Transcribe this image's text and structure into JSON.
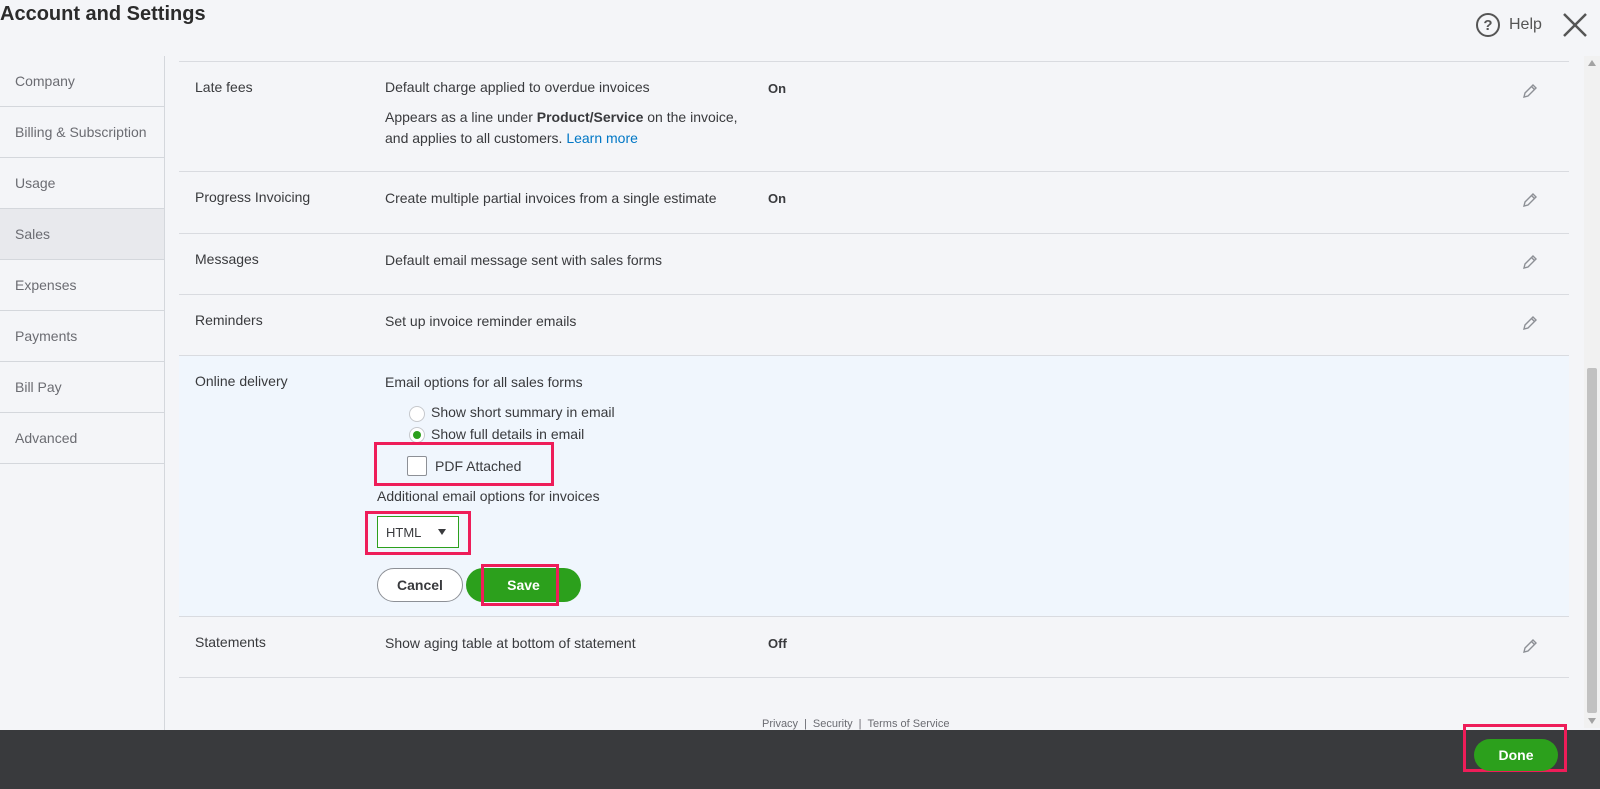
{
  "header": {
    "title": "Account and Settings",
    "help_label": "Help"
  },
  "sidebar": {
    "items": [
      {
        "label": "Company"
      },
      {
        "label": "Billing & Subscription"
      },
      {
        "label": "Usage"
      },
      {
        "label": "Sales",
        "active": true
      },
      {
        "label": "Expenses"
      },
      {
        "label": "Payments"
      },
      {
        "label": "Bill Pay"
      },
      {
        "label": "Advanced"
      }
    ]
  },
  "settings": {
    "late_fees": {
      "label": "Late fees",
      "desc_line1": "Default charge applied to overdue invoices",
      "desc_line2_pre": "Appears as a line under ",
      "desc_line2_bold": "Product/Service",
      "desc_line2_post": " on the invoice,",
      "desc_line3": "and applies to all customers. ",
      "learn_more": "Learn more",
      "status": "On"
    },
    "progress_invoicing": {
      "label": "Progress Invoicing",
      "desc": "Create multiple partial invoices from a single estimate",
      "status": "On"
    },
    "messages": {
      "label": "Messages",
      "desc": "Default email message sent with sales forms"
    },
    "reminders": {
      "label": "Reminders",
      "desc": "Set up invoice reminder emails"
    },
    "online_delivery": {
      "label": "Online delivery",
      "email_options_label": "Email options for all sales forms",
      "radio_short": "Show short summary in email",
      "radio_full": "Show full details in email",
      "pdf_attached": "PDF Attached",
      "additional_label": "Additional email options for invoices",
      "format_value": "HTML",
      "cancel_label": "Cancel",
      "save_label": "Save"
    },
    "statements": {
      "label": "Statements",
      "desc": "Show aging table at bottom of statement",
      "status": "Off"
    }
  },
  "footer": {
    "privacy": "Privacy",
    "security": "Security",
    "terms": "Terms of Service",
    "sep": "|"
  },
  "bottom_bar": {
    "done_label": "Done"
  },
  "colors": {
    "accent_green": "#2ca01c",
    "highlight": "#ee1d59",
    "link": "#0077c5",
    "bottom_bar": "#393a3d"
  }
}
